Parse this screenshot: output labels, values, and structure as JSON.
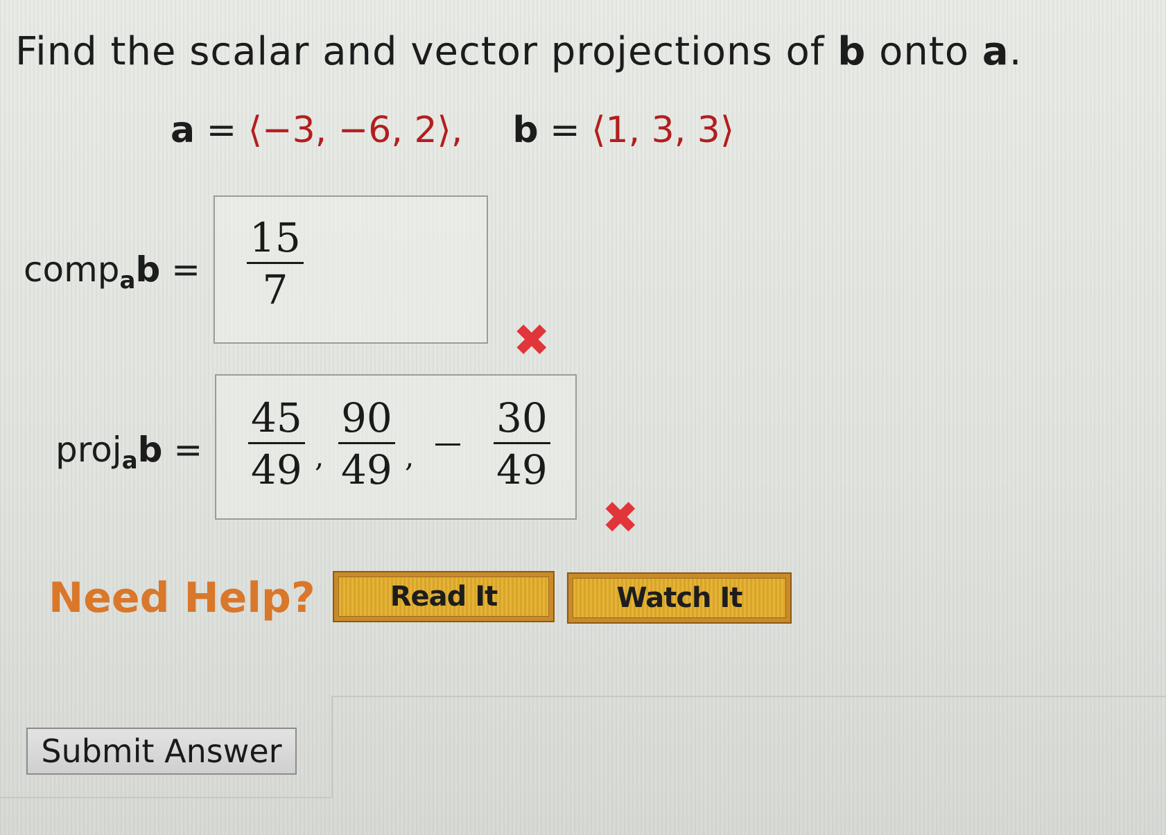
{
  "question": {
    "prefix": "Find the scalar and vector projections of ",
    "b": "b",
    "middle": " onto ",
    "a": "a",
    "suffix": "."
  },
  "vectors": {
    "a_label": "a",
    "equals": " = ",
    "a_value": "⟨−3, −6, 2⟩,",
    "b_label": "b",
    "b_value": "⟨1, 3, 3⟩"
  },
  "comp": {
    "label_main": "comp",
    "label_sub": "a",
    "label_vec": "b",
    "label_eq": " =",
    "answer": {
      "numerator": "15",
      "denominator": "7"
    },
    "status": "incorrect",
    "status_glyph": "✖"
  },
  "proj": {
    "label_main": "proj",
    "label_sub": "a",
    "label_vec": "b",
    "label_eq": " =",
    "answer": [
      {
        "sign": "",
        "numerator": "45",
        "denominator": "49"
      },
      {
        "sign": "",
        "numerator": "90",
        "denominator": "49"
      },
      {
        "sign": "-",
        "numerator": "30",
        "denominator": "49"
      }
    ],
    "separator": ",",
    "status": "incorrect",
    "status_glyph": "✖"
  },
  "help": {
    "label": "Need Help?",
    "read_button": "Read It",
    "watch_button": "Watch It"
  },
  "submit": {
    "label": "Submit Answer"
  },
  "colors": {
    "vector_values": "#b21e1e",
    "incorrect_mark": "#e0353a",
    "need_help": "#d9772a",
    "help_button": "#e4b436"
  }
}
